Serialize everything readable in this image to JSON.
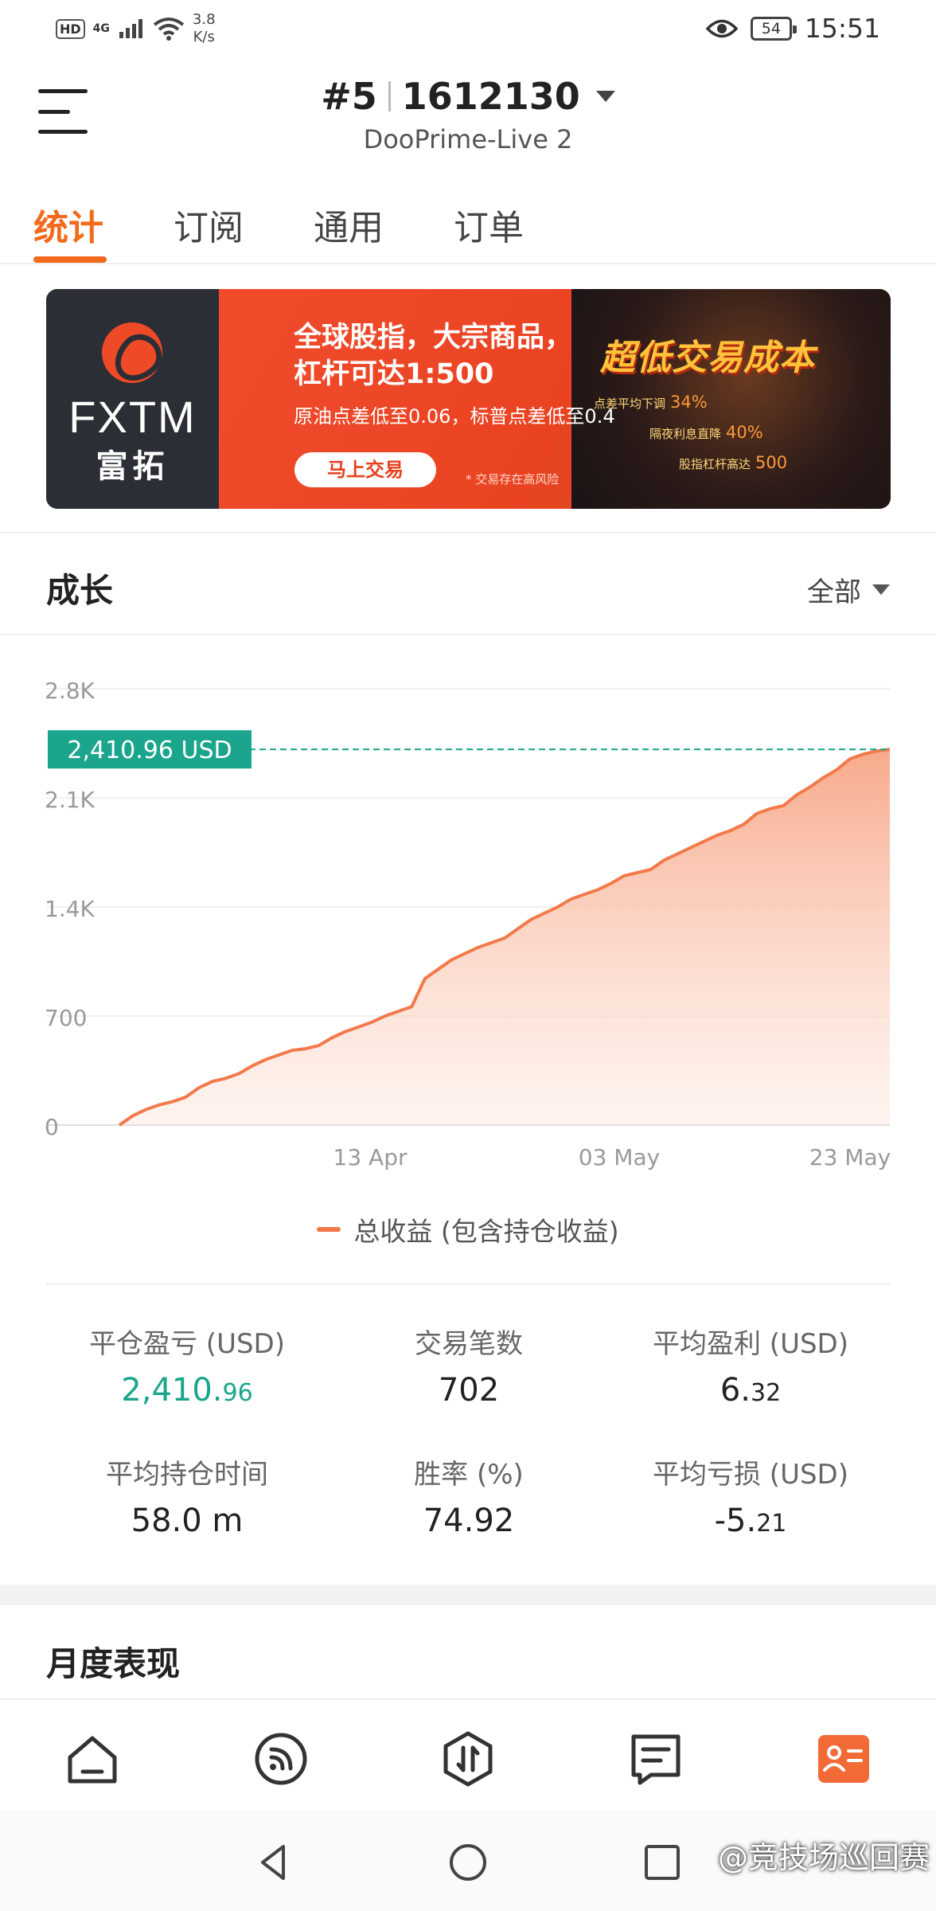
{
  "status_bar": {
    "hd": "HD",
    "network": "4G",
    "speed_value": "3.8",
    "speed_unit": "K/s",
    "battery": "54",
    "time": "15:51"
  },
  "header": {
    "rank": "#5",
    "account": "1612130",
    "server": "DooPrime-Live 2"
  },
  "tabs": [
    "统计",
    "订阅",
    "通用",
    "订单"
  ],
  "banner": {
    "brand": "FXTM",
    "brand_cn": "富拓",
    "headline_1": "全球股指，大宗商品，",
    "headline_2": "杠杆可达1:500",
    "subline": "原油点差低至0.06，标普点差低至0.4",
    "cta": "马上交易",
    "risk": "* 交易存在高风险",
    "right_title": "超低交易成本",
    "features": [
      {
        "label": "点差平均下调",
        "value": "34%"
      },
      {
        "label": "隔夜利息直降",
        "value": "40%"
      },
      {
        "label": "股指杠杆高达",
        "value": "500"
      }
    ]
  },
  "growth": {
    "title": "成长",
    "filter": "全部"
  },
  "chart_data": {
    "type": "area",
    "y_ticks": [
      "2.8K",
      "2.1K",
      "1.4K",
      "700",
      "0"
    ],
    "ylim": [
      0,
      2800
    ],
    "x_ticks": [
      "13 Apr",
      "03 May",
      "23 May"
    ],
    "current_value_label": "2,410.96 USD",
    "current_value": 2410.96,
    "legend": "总收益 (包含持仓收益)",
    "color": "#f27a4a",
    "series": [
      {
        "name": "总收益 (包含持仓收益)",
        "values": [
          0,
          60,
          100,
          130,
          150,
          180,
          240,
          280,
          300,
          330,
          380,
          420,
          450,
          480,
          490,
          510,
          560,
          600,
          630,
          660,
          700,
          730,
          760,
          940,
          1000,
          1060,
          1100,
          1140,
          1170,
          1200,
          1260,
          1320,
          1360,
          1400,
          1450,
          1480,
          1510,
          1550,
          1600,
          1620,
          1640,
          1700,
          1740,
          1780,
          1820,
          1860,
          1890,
          1930,
          2000,
          2030,
          2050,
          2120,
          2170,
          2230,
          2280,
          2350,
          2380,
          2400,
          2410.96
        ]
      }
    ]
  },
  "stats": [
    {
      "label": "平仓盈亏 (USD)",
      "value_main": "2,410.",
      "value_small": "96",
      "color": "#1aa58c"
    },
    {
      "label": "交易笔数",
      "value_main": "702",
      "value_small": ""
    },
    {
      "label": "平均盈利 (USD)",
      "value_main": "6.",
      "value_small": "32"
    },
    {
      "label": "平均持仓时间",
      "value_main": "58.0 m",
      "value_small": ""
    },
    {
      "label": "胜率 (%)",
      "value_main": "74.92",
      "value_small": ""
    },
    {
      "label": "平均亏损 (USD)",
      "value_main": "-5.",
      "value_small": "21"
    }
  ],
  "monthly": {
    "title": "月度表现"
  },
  "bottom_nav": [
    "home-icon",
    "feed-icon",
    "trade-icon",
    "message-icon",
    "profile-card-icon"
  ],
  "watermark": "@竞技场巡回赛"
}
